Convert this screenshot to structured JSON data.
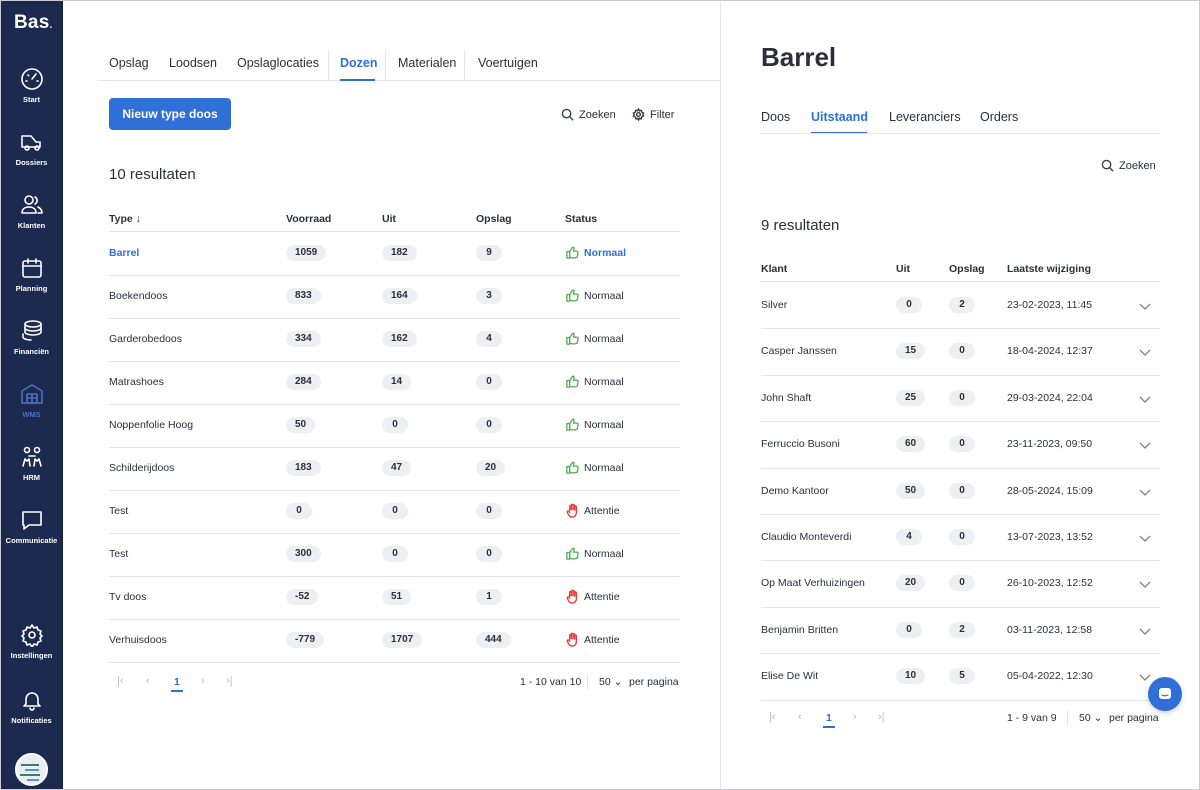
{
  "app": {
    "logo": "Bas",
    "logo_dot": "."
  },
  "sidebar": {
    "items": [
      {
        "label": "Start",
        "icon": "speedometer-icon"
      },
      {
        "label": "Dossiers",
        "icon": "truck-icon"
      },
      {
        "label": "Klanten",
        "icon": "users-icon"
      },
      {
        "label": "Planning",
        "icon": "calendar-icon"
      },
      {
        "label": "Financiën",
        "icon": "coins-icon"
      },
      {
        "label": "WMS",
        "icon": "warehouse-icon"
      },
      {
        "label": "HRM",
        "icon": "people-icon"
      },
      {
        "label": "Communicatie",
        "icon": "chat-icon"
      },
      {
        "label": "Instellingen",
        "icon": "gear-icon"
      },
      {
        "label": "Notificaties",
        "icon": "bell-icon"
      }
    ],
    "active": "WMS"
  },
  "left": {
    "tabs": [
      "Opslag",
      "Loodsen",
      "Opslaglocaties",
      "Dozen",
      "Materialen",
      "Voertuigen"
    ],
    "active_tab": "Dozen",
    "new_button": "Nieuw type doos",
    "search_label": "Zoeken",
    "filter_label": "Filter",
    "results": "10 resultaten",
    "columns": {
      "type": "Type",
      "sort_indicator": "↓",
      "voorraad": "Voorraad",
      "uit": "Uit",
      "opslag": "Opslag",
      "status": "Status"
    },
    "rows": [
      {
        "type": "Barrel",
        "voorraad": "1059",
        "uit": "182",
        "opslag": "9",
        "status": "Normaal",
        "status_kind": "ok",
        "selected": true
      },
      {
        "type": "Boekendoos",
        "voorraad": "833",
        "uit": "164",
        "opslag": "3",
        "status": "Normaal",
        "status_kind": "ok"
      },
      {
        "type": "Garderobedoos",
        "voorraad": "334",
        "uit": "162",
        "opslag": "4",
        "status": "Normaal",
        "status_kind": "ok"
      },
      {
        "type": "Matrashoes",
        "voorraad": "284",
        "uit": "14",
        "opslag": "0",
        "status": "Normaal",
        "status_kind": "ok"
      },
      {
        "type": "Noppenfolie Hoog",
        "voorraad": "50",
        "uit": "0",
        "opslag": "0",
        "status": "Normaal",
        "status_kind": "ok"
      },
      {
        "type": "Schilderijdoos",
        "voorraad": "183",
        "uit": "47",
        "opslag": "20",
        "status": "Normaal",
        "status_kind": "ok"
      },
      {
        "type": "Test",
        "voorraad": "0",
        "uit": "0",
        "opslag": "0",
        "status": "Attentie",
        "status_kind": "warn"
      },
      {
        "type": "Test",
        "voorraad": "300",
        "uit": "0",
        "opslag": "0",
        "status": "Normaal",
        "status_kind": "ok"
      },
      {
        "type": "Tv doos",
        "voorraad": "-52",
        "uit": "51",
        "opslag": "1",
        "status": "Attentie",
        "status_kind": "warn"
      },
      {
        "type": "Verhuisdoos",
        "voorraad": "-779",
        "uit": "1707",
        "opslag": "444",
        "status": "Attentie",
        "status_kind": "warn"
      }
    ],
    "pagination": {
      "current_page": "1",
      "range": "1 - 10 van 10",
      "per_page": "50",
      "per_page_label": "per pagina"
    }
  },
  "right": {
    "title": "Barrel",
    "tabs": [
      "Doos",
      "Uitstaand",
      "Leveranciers",
      "Orders"
    ],
    "active_tab": "Uitstaand",
    "search_label": "Zoeken",
    "results": "9 resultaten",
    "columns": {
      "klant": "Klant",
      "uit": "Uit",
      "opslag": "Opslag",
      "laatste": "Laatste wijziging"
    },
    "rows": [
      {
        "klant": "Silver",
        "uit": "0",
        "opslag": "2",
        "datum": "23-02-2023, 11:45"
      },
      {
        "klant": "Casper Janssen",
        "uit": "15",
        "opslag": "0",
        "datum": "18-04-2024, 12:37"
      },
      {
        "klant": "John Shaft",
        "uit": "25",
        "opslag": "0",
        "datum": "29-03-2024, 22:04"
      },
      {
        "klant": "Ferruccio Busoni",
        "uit": "60",
        "opslag": "0",
        "datum": "23-11-2023, 09:50"
      },
      {
        "klant": "Demo Kantoor",
        "uit": "50",
        "opslag": "0",
        "datum": "28-05-2024, 15:09"
      },
      {
        "klant": "Claudio Monteverdi",
        "uit": "4",
        "opslag": "0",
        "datum": "13-07-2023, 13:52"
      },
      {
        "klant": "Op Maat Verhuizingen",
        "uit": "20",
        "opslag": "0",
        "datum": "26-10-2023, 12:52"
      },
      {
        "klant": "Benjamin Britten",
        "uit": "0",
        "opslag": "2",
        "datum": "03-11-2023, 12:58"
      },
      {
        "klant": "Elise De Wit",
        "uit": "10",
        "opslag": "5",
        "datum": "05-04-2022, 12:30"
      }
    ],
    "pagination": {
      "current_page": "1",
      "range": "1 - 9 van 9",
      "per_page": "50",
      "per_page_label": "per pagina"
    }
  },
  "colors": {
    "sidebar": "#1b2a4e",
    "accent": "#2f6fd6",
    "ok": "#4caf50",
    "warn": "#e53935"
  }
}
